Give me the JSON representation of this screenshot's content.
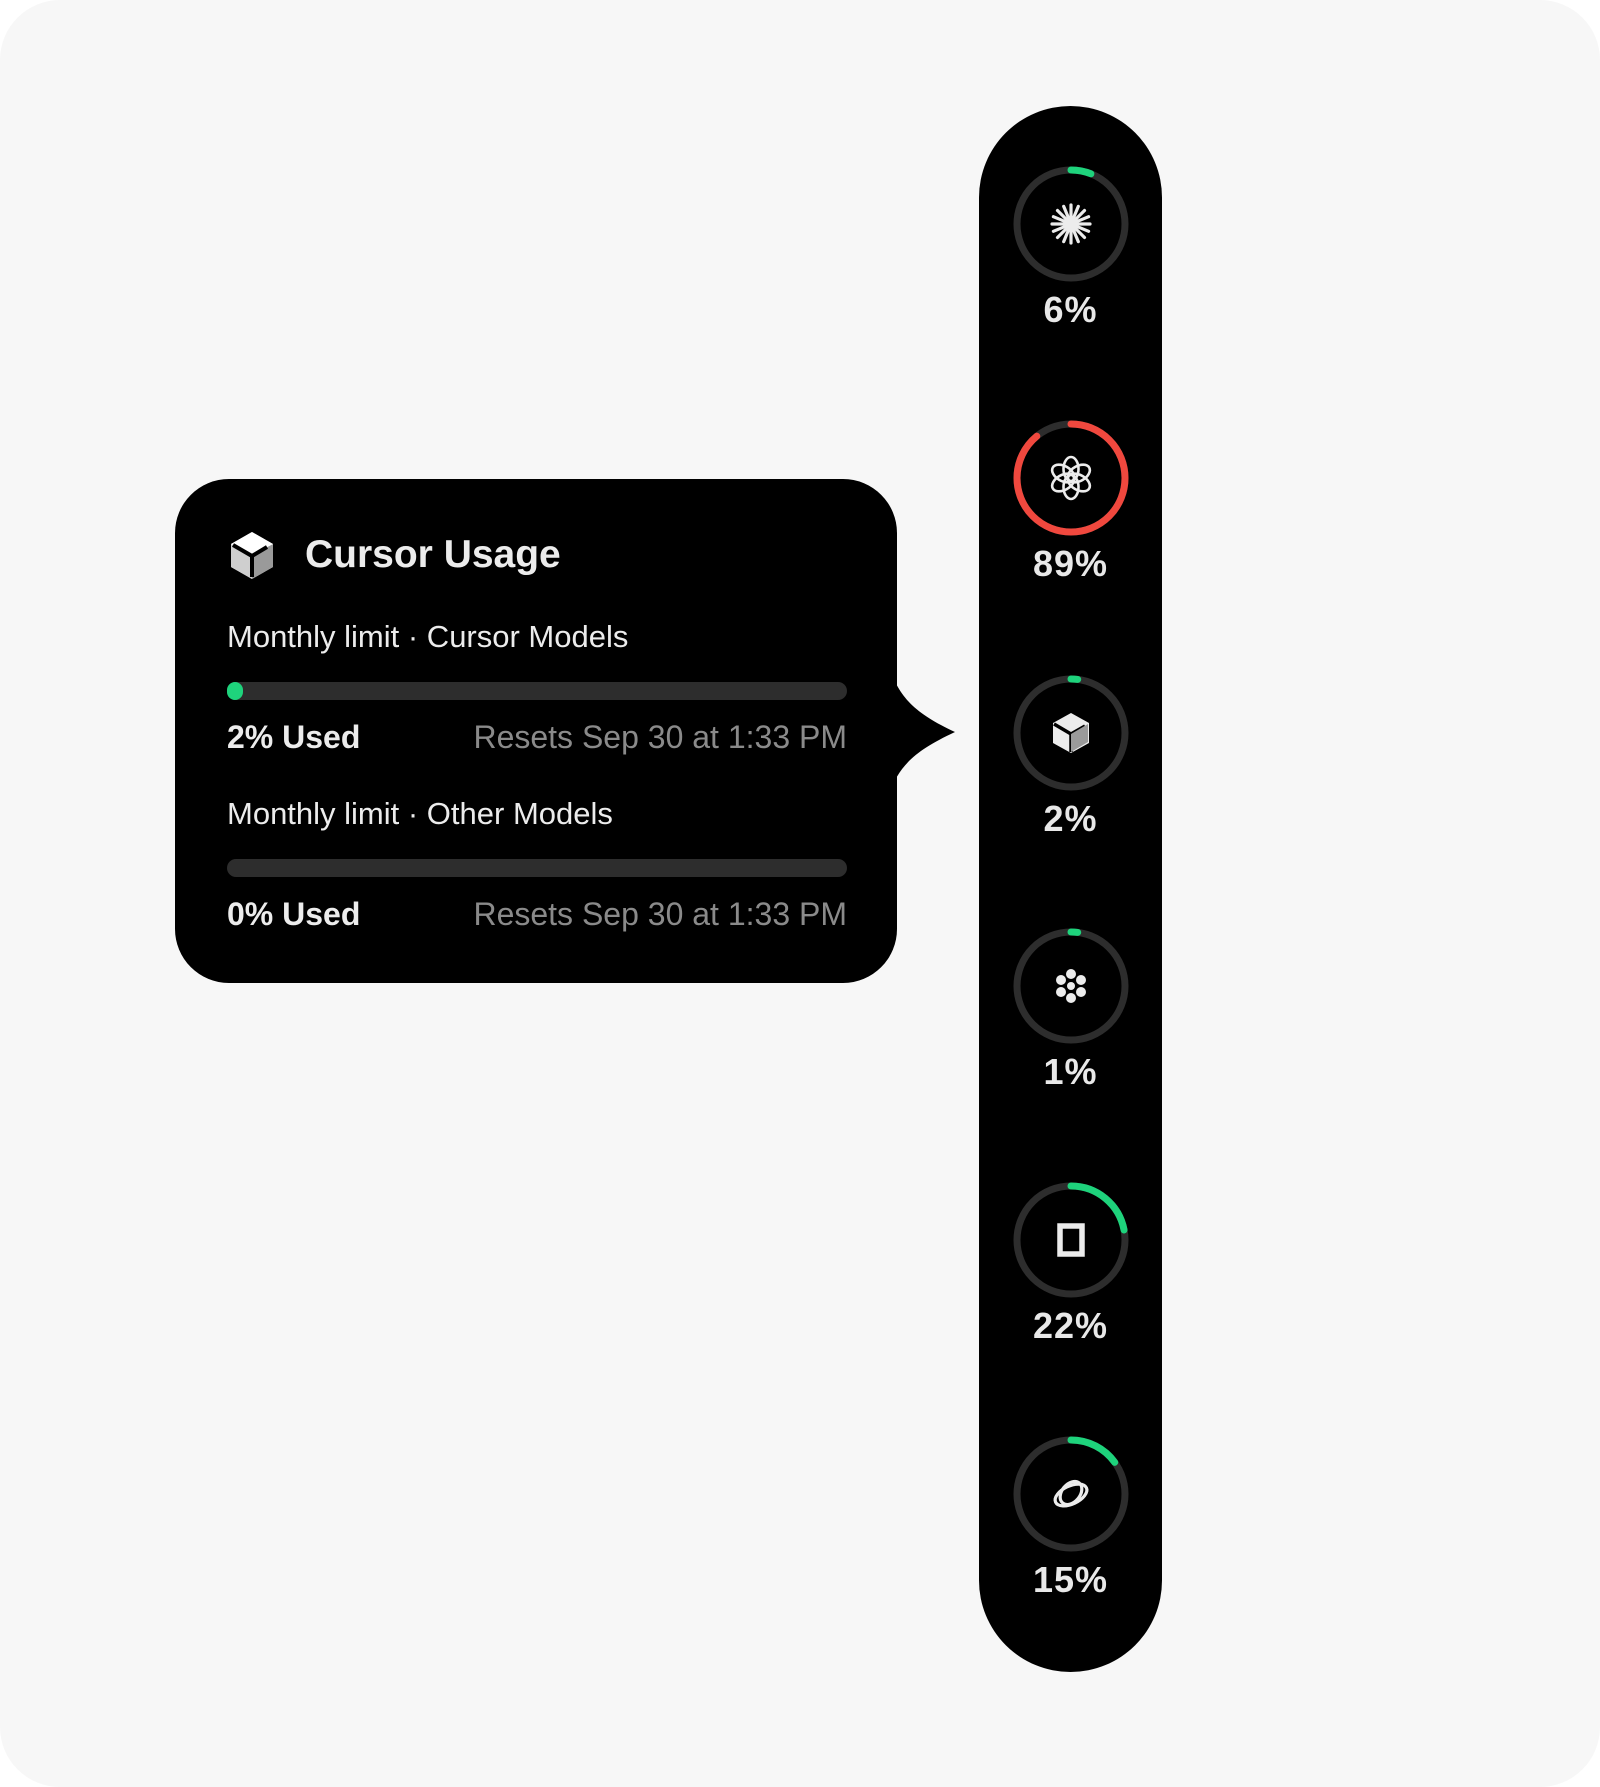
{
  "colors": {
    "accent_green": "#1ed37c",
    "alert_red": "#f0483e",
    "track": "#2d2d2d",
    "panel": "#000000"
  },
  "popover": {
    "icon": "cursor-cube-icon",
    "title": "Cursor Usage",
    "limits": [
      {
        "label": "Monthly limit · Cursor Models",
        "used_fraction": 0.02,
        "used_text": "2% Used",
        "reset_text": "Resets Sep 30 at 1:33 PM"
      },
      {
        "label": "Monthly limit · Other Models",
        "used_fraction": 0.0,
        "used_text": "0% Used",
        "reset_text": "Resets Sep 30 at 1:33 PM"
      }
    ]
  },
  "providers": [
    {
      "icon": "claude-sparkle-icon",
      "percent": 6,
      "percent_text": "6%",
      "color": "#1ed37c"
    },
    {
      "icon": "openai-knot-icon",
      "percent": 89,
      "percent_text": "89%",
      "color": "#f0483e"
    },
    {
      "icon": "cursor-cube-icon",
      "percent": 2,
      "percent_text": "2%",
      "color": "#1ed37c"
    },
    {
      "icon": "flower-dots-icon",
      "percent": 1,
      "percent_text": "1%",
      "color": "#1ed37c"
    },
    {
      "icon": "square-frame-icon",
      "percent": 22,
      "percent_text": "22%",
      "color": "#1ed37c"
    },
    {
      "icon": "orbit-rings-icon",
      "percent": 15,
      "percent_text": "15%",
      "color": "#1ed37c"
    }
  ]
}
